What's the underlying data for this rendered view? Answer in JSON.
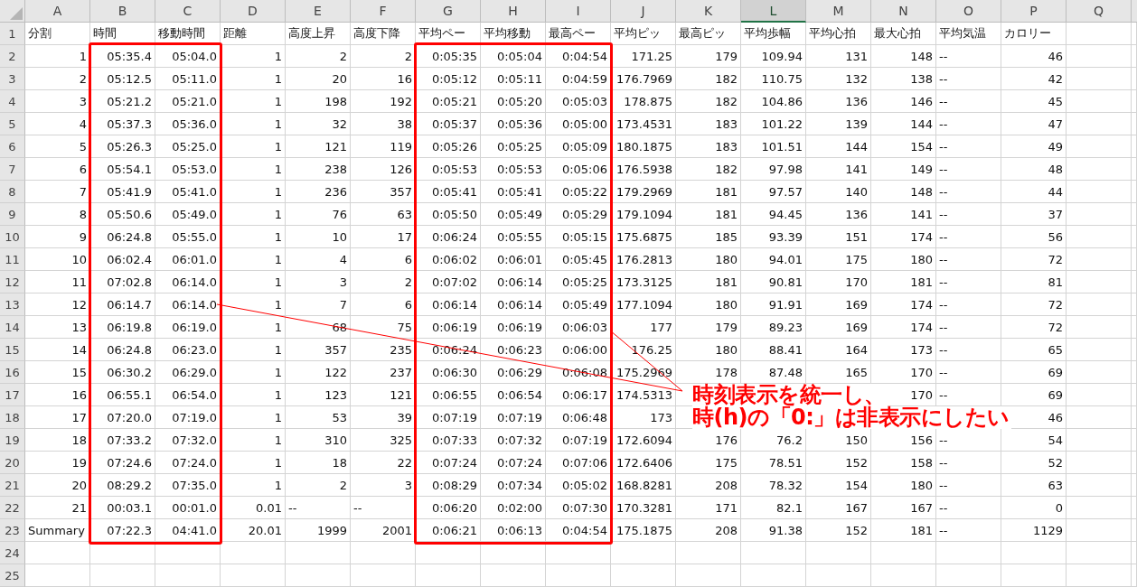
{
  "columns": [
    {
      "label": "A",
      "selected": false
    },
    {
      "label": "B",
      "selected": false
    },
    {
      "label": "C",
      "selected": false
    },
    {
      "label": "D",
      "selected": false
    },
    {
      "label": "E",
      "selected": false
    },
    {
      "label": "F",
      "selected": false
    },
    {
      "label": "G",
      "selected": false
    },
    {
      "label": "H",
      "selected": false
    },
    {
      "label": "I",
      "selected": false
    },
    {
      "label": "J",
      "selected": false
    },
    {
      "label": "K",
      "selected": false
    },
    {
      "label": "L",
      "selected": true
    },
    {
      "label": "M",
      "selected": false
    },
    {
      "label": "N",
      "selected": false
    },
    {
      "label": "O",
      "selected": false
    },
    {
      "label": "P",
      "selected": false
    },
    {
      "label": "Q",
      "selected": false
    }
  ],
  "rows": [
    {
      "number": "1",
      "kind": "header",
      "cells": [
        "分割",
        "時間",
        "移動時間",
        "距離",
        "高度上昇",
        "高度下降",
        "平均ペー",
        "平均移動",
        "最高ペー",
        "平均ピッ",
        "最高ピッ",
        "平均歩幅",
        "平均心拍",
        "最大心拍",
        "平均気温",
        "カロリー"
      ]
    },
    {
      "number": "2",
      "kind": "data",
      "cells": [
        "1",
        "05:35.4",
        "05:04.0",
        "1",
        "2",
        "2",
        "0:05:35",
        "0:05:04",
        "0:04:54",
        "171.25",
        "179",
        "109.94",
        "131",
        "148",
        {
          "text": "--",
          "kind": "text"
        },
        "46"
      ]
    },
    {
      "number": "3",
      "kind": "data",
      "cells": [
        "2",
        "05:12.5",
        "05:11.0",
        "1",
        "20",
        "16",
        "0:05:12",
        "0:05:11",
        "0:04:59",
        "176.7969",
        "182",
        "110.75",
        "132",
        "138",
        {
          "text": "--",
          "kind": "text"
        },
        "42"
      ]
    },
    {
      "number": "4",
      "kind": "data",
      "cells": [
        "3",
        "05:21.2",
        "05:21.0",
        "1",
        "198",
        "192",
        "0:05:21",
        "0:05:20",
        "0:05:03",
        "178.875",
        "182",
        "104.86",
        "136",
        "146",
        {
          "text": "--",
          "kind": "text"
        },
        "45"
      ]
    },
    {
      "number": "5",
      "kind": "data",
      "cells": [
        "4",
        "05:37.3",
        "05:36.0",
        "1",
        "32",
        "38",
        "0:05:37",
        "0:05:36",
        "0:05:00",
        "173.4531",
        "183",
        "101.22",
        "139",
        "144",
        {
          "text": "--",
          "kind": "text"
        },
        "47"
      ]
    },
    {
      "number": "6",
      "kind": "data",
      "cells": [
        "5",
        "05:26.3",
        "05:25.0",
        "1",
        "121",
        "119",
        "0:05:26",
        "0:05:25",
        "0:05:09",
        "180.1875",
        "183",
        "101.51",
        "144",
        "154",
        {
          "text": "--",
          "kind": "text"
        },
        "49"
      ]
    },
    {
      "number": "7",
      "kind": "data",
      "cells": [
        "6",
        "05:54.1",
        "05:53.0",
        "1",
        "238",
        "126",
        "0:05:53",
        "0:05:53",
        "0:05:06",
        "176.5938",
        "182",
        "97.98",
        "141",
        "149",
        {
          "text": "--",
          "kind": "text"
        },
        "48"
      ]
    },
    {
      "number": "8",
      "kind": "data",
      "cells": [
        "7",
        "05:41.9",
        "05:41.0",
        "1",
        "236",
        "357",
        "0:05:41",
        "0:05:41",
        "0:05:22",
        "179.2969",
        "181",
        "97.57",
        "140",
        "148",
        {
          "text": "--",
          "kind": "text"
        },
        "44"
      ]
    },
    {
      "number": "9",
      "kind": "data",
      "cells": [
        "8",
        "05:50.6",
        "05:49.0",
        "1",
        "76",
        "63",
        "0:05:50",
        "0:05:49",
        "0:05:29",
        "179.1094",
        "181",
        "94.45",
        "136",
        "141",
        {
          "text": "--",
          "kind": "text"
        },
        "37"
      ]
    },
    {
      "number": "10",
      "kind": "data",
      "cells": [
        "9",
        "06:24.8",
        "05:55.0",
        "1",
        "10",
        "17",
        "0:06:24",
        "0:05:55",
        "0:05:15",
        "175.6875",
        "185",
        "93.39",
        "151",
        "174",
        {
          "text": "--",
          "kind": "text"
        },
        "56"
      ]
    },
    {
      "number": "11",
      "kind": "data",
      "cells": [
        "10",
        "06:02.4",
        "06:01.0",
        "1",
        "4",
        "6",
        "0:06:02",
        "0:06:01",
        "0:05:45",
        "176.2813",
        "180",
        "94.01",
        "175",
        "180",
        {
          "text": "--",
          "kind": "text"
        },
        "72"
      ]
    },
    {
      "number": "12",
      "kind": "data",
      "cells": [
        "11",
        "07:02.8",
        "06:14.0",
        "1",
        "3",
        "2",
        "0:07:02",
        "0:06:14",
        "0:05:25",
        "173.3125",
        "181",
        "90.81",
        "170",
        "181",
        {
          "text": "--",
          "kind": "text"
        },
        "81"
      ]
    },
    {
      "number": "13",
      "kind": "data",
      "cells": [
        "12",
        "06:14.7",
        "06:14.0",
        "1",
        "7",
        "6",
        "0:06:14",
        "0:06:14",
        "0:05:49",
        "177.1094",
        "180",
        "91.91",
        "169",
        "174",
        {
          "text": "--",
          "kind": "text"
        },
        "72"
      ]
    },
    {
      "number": "14",
      "kind": "data",
      "cells": [
        "13",
        "06:19.8",
        "06:19.0",
        "1",
        "68",
        "75",
        "0:06:19",
        "0:06:19",
        "0:06:03",
        "177",
        "179",
        "89.23",
        "169",
        "174",
        {
          "text": "--",
          "kind": "text"
        },
        "72"
      ]
    },
    {
      "number": "15",
      "kind": "data",
      "cells": [
        "14",
        "06:24.8",
        "06:23.0",
        "1",
        "357",
        "235",
        "0:06:24",
        "0:06:23",
        "0:06:00",
        "176.25",
        "180",
        "88.41",
        "164",
        "173",
        {
          "text": "--",
          "kind": "text"
        },
        "65"
      ]
    },
    {
      "number": "16",
      "kind": "data",
      "cells": [
        "15",
        "06:30.2",
        "06:29.0",
        "1",
        "122",
        "237",
        "0:06:30",
        "0:06:29",
        "0:06:08",
        "175.2969",
        "178",
        "87.48",
        "165",
        "170",
        {
          "text": "--",
          "kind": "text"
        },
        "69"
      ]
    },
    {
      "number": "17",
      "kind": "data",
      "cells": [
        "16",
        "06:55.1",
        "06:54.0",
        "1",
        "123",
        "121",
        "0:06:55",
        "0:06:54",
        "0:06:17",
        "174.5313",
        null,
        null,
        null,
        "170",
        {
          "text": "--",
          "kind": "text"
        },
        "69"
      ]
    },
    {
      "number": "18",
      "kind": "data",
      "cells": [
        "17",
        "07:20.0",
        "07:19.0",
        "1",
        "53",
        "39",
        "0:07:19",
        "0:07:19",
        "0:06:48",
        "173",
        null,
        null,
        null,
        null,
        null,
        "46"
      ]
    },
    {
      "number": "19",
      "kind": "data",
      "cells": [
        "18",
        "07:33.2",
        "07:32.0",
        "1",
        "310",
        "325",
        "0:07:33",
        "0:07:32",
        "0:07:19",
        "172.6094",
        "176",
        "76.2",
        "150",
        "156",
        {
          "text": "--",
          "kind": "text"
        },
        "54"
      ]
    },
    {
      "number": "20",
      "kind": "data",
      "cells": [
        "19",
        "07:24.6",
        "07:24.0",
        "1",
        "18",
        "22",
        "0:07:24",
        "0:07:24",
        "0:07:06",
        "172.6406",
        "175",
        "78.51",
        "152",
        "158",
        {
          "text": "--",
          "kind": "text"
        },
        "52"
      ]
    },
    {
      "number": "21",
      "kind": "data",
      "cells": [
        "20",
        "08:29.2",
        "07:35.0",
        "1",
        "2",
        "3",
        "0:08:29",
        "0:07:34",
        "0:05:02",
        "168.8281",
        "208",
        "78.32",
        "154",
        "180",
        {
          "text": "--",
          "kind": "text"
        },
        "63"
      ]
    },
    {
      "number": "22",
      "kind": "data",
      "cells": [
        "21",
        "00:03.1",
        "00:01.0",
        "0.01",
        {
          "text": "--",
          "kind": "text"
        },
        {
          "text": "--",
          "kind": "text"
        },
        "0:06:20",
        "0:02:00",
        "0:07:30",
        "170.3281",
        "171",
        "82.1",
        "167",
        "167",
        {
          "text": "--",
          "kind": "text"
        },
        "0"
      ]
    },
    {
      "number": "23",
      "kind": "data",
      "cells": [
        {
          "text": "Summary",
          "kind": "text"
        },
        "07:22.3",
        "04:41.0",
        "20.01",
        "1999",
        "2001",
        "0:06:21",
        "0:06:13",
        "0:04:54",
        "175.1875",
        "208",
        "91.38",
        "152",
        "181",
        {
          "text": "--",
          "kind": "text"
        },
        "1129"
      ]
    },
    {
      "number": "24"
    },
    {
      "number": "25"
    }
  ],
  "annotation": {
    "lines": [
      "時刻表示を統一し、",
      "時(h)の「0:」は非表示にしたい"
    ]
  }
}
